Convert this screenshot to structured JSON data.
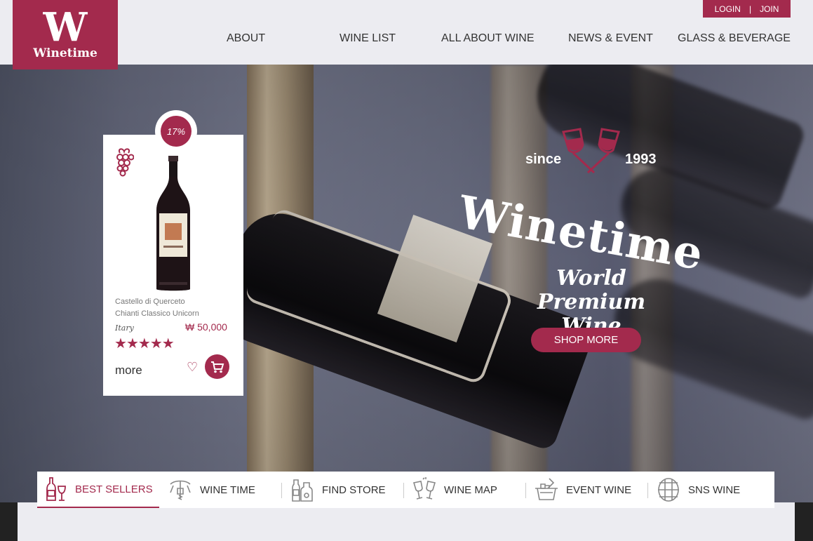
{
  "logo": {
    "mark": "W",
    "name": "Winetime"
  },
  "auth": {
    "login": "LOGIN",
    "separator": "|",
    "join": "JOIN"
  },
  "nav": [
    "ABOUT",
    "WINE LIST",
    "ALL ABOUT WINE",
    "NEWS & EVENT",
    "GLASS & BEVERAGE"
  ],
  "product": {
    "discount": "17%",
    "name_line1": "Castello di Querceto",
    "name_line2": "Chianti Classico Unicorn",
    "origin": "Itary",
    "price": "₩ 50,000",
    "rating": 5,
    "more": "more"
  },
  "hero": {
    "since": "since",
    "year": "1993",
    "brand": "Winetime",
    "tagline1": "World",
    "tagline2": "Premium Wine",
    "shop": "SHOP MORE"
  },
  "tabs": [
    {
      "label": "BEST SELLERS",
      "icon": "bottle-glass-icon",
      "active": true
    },
    {
      "label": "WINE TIME",
      "icon": "corkscrew-icon",
      "active": false
    },
    {
      "label": "FIND STORE",
      "icon": "bottles-icon",
      "active": false
    },
    {
      "label": "WINE MAP",
      "icon": "cheers-icon",
      "active": false
    },
    {
      "label": "EVENT WINE",
      "icon": "ice-bucket-icon",
      "active": false
    },
    {
      "label": "SNS WINE",
      "icon": "barrel-icon",
      "active": false
    }
  ],
  "colors": {
    "brand": "#a32a4d",
    "background": "#ececf1"
  }
}
